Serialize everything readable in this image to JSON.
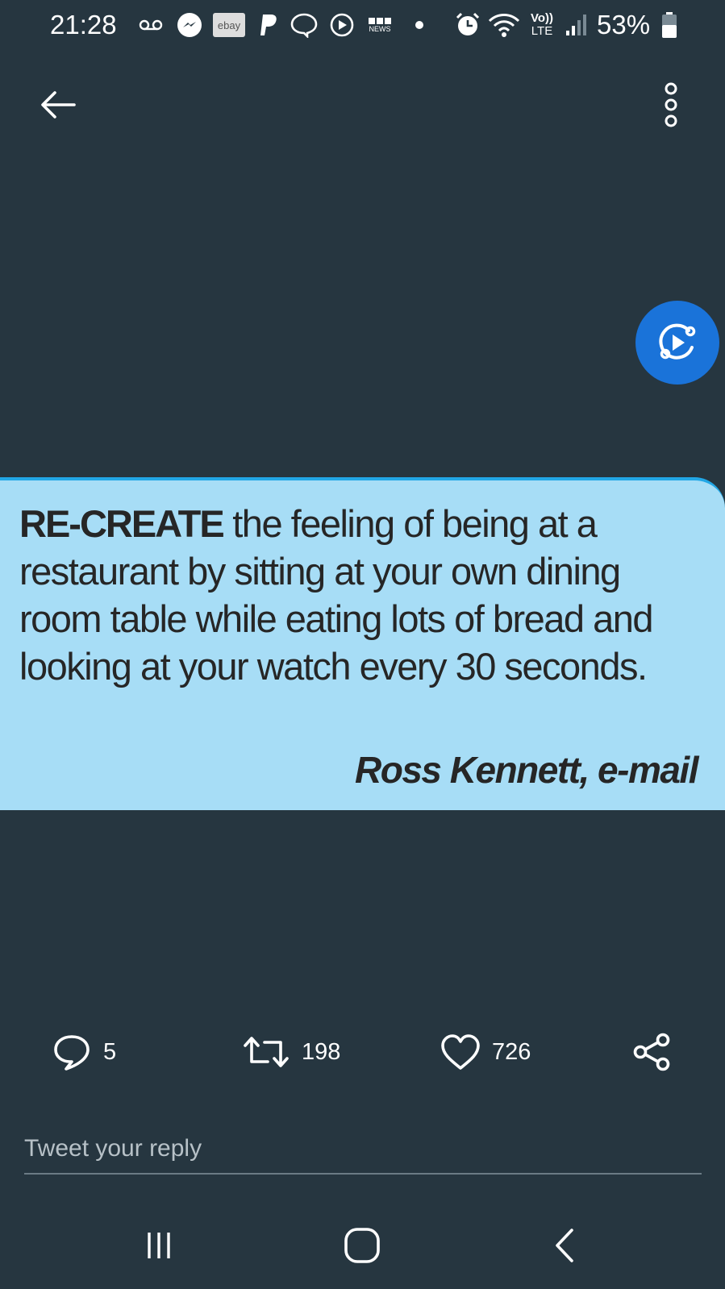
{
  "status_bar": {
    "time": "21:28",
    "battery": "53%",
    "network_type": "LTE",
    "volte": "Vo))",
    "notification_icons": [
      "voicemail-icon",
      "messenger-icon",
      "ebay-icon",
      "paypal-icon",
      "chat-icon",
      "media-player-icon",
      "bbc-news-icon",
      "dot-icon"
    ],
    "ebay_label": "ebay",
    "news_label": "NEWS",
    "system_icons": [
      "alarm-icon",
      "wifi-icon",
      "signal-icon",
      "battery-icon"
    ]
  },
  "top_bar": {
    "back_icon": "arrow-left-icon",
    "more_icon": "more-vertical-icon"
  },
  "media_button": {
    "icon": "media-play-icon",
    "color": "#1a73d9"
  },
  "tweet_image": {
    "lead": "RE-CREATE",
    "body": " the feeling of being at a restaurant by sitting at your own dining room table while eating lots of bread and looking at your watch every 30 seconds.",
    "attribution": "Ross Kennett, e-mail",
    "background": "#a7ddf6"
  },
  "actions": {
    "reply_count": "5",
    "retweet_count": "198",
    "like_count": "726"
  },
  "reply_box": {
    "placeholder": "Tweet your reply"
  },
  "nav_bar": {
    "items": [
      "recent-apps-icon",
      "home-icon",
      "back-icon"
    ]
  },
  "colors": {
    "background": "#263640",
    "accent": "#1a73d9"
  }
}
